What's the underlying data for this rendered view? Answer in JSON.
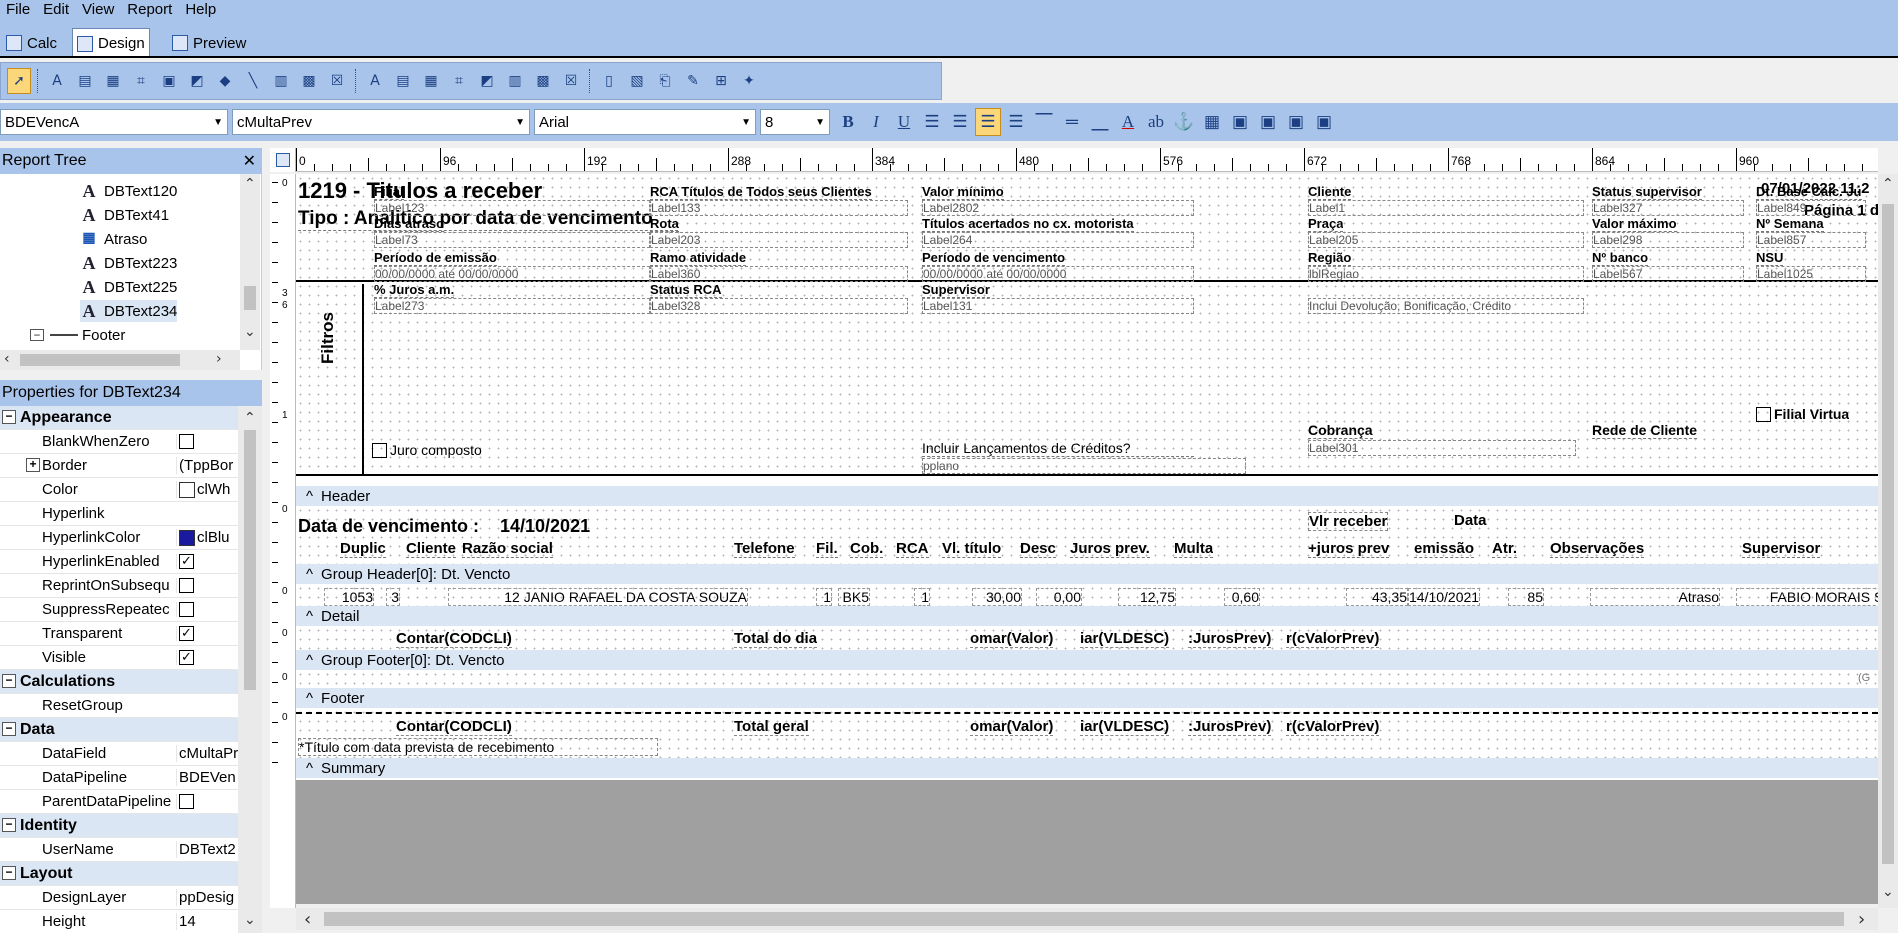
{
  "menu": [
    "File",
    "Edit",
    "View",
    "Report",
    "Help"
  ],
  "view_tabs": [
    "Calc",
    "Design",
    "Preview"
  ],
  "toolbar2": {
    "pipeline": "BDEVencA",
    "field": "cMultaPrev",
    "font": "Arial",
    "size": "8"
  },
  "tree": {
    "title": "Report Tree",
    "items": [
      "DBText120",
      "DBText41",
      "Atraso",
      "DBText223",
      "DBText225",
      "DBText234",
      "Footer"
    ]
  },
  "props": {
    "title": "Properties for DBText234",
    "rows": [
      {
        "cat": true,
        "name": "Appearance"
      },
      {
        "name": "BlankWhenZero",
        "check": ""
      },
      {
        "name": "Border",
        "value": "(TppBor",
        "expand": "+"
      },
      {
        "name": "Color",
        "value": "clWh",
        "swatch": "#ffffff"
      },
      {
        "name": "Hyperlink",
        "value": ""
      },
      {
        "name": "HyperlinkColor",
        "value": "clBlu",
        "swatch": "#1a1a9e"
      },
      {
        "name": "HyperlinkEnabled",
        "check": "✓"
      },
      {
        "name": "ReprintOnSubsequ",
        "check": ""
      },
      {
        "name": "SuppressRepeatec",
        "check": ""
      },
      {
        "name": "Transparent",
        "check": "✓"
      },
      {
        "name": "Visible",
        "check": "✓"
      },
      {
        "cat": true,
        "name": "Calculations"
      },
      {
        "name": "ResetGroup",
        "value": ""
      },
      {
        "cat": true,
        "name": "Data"
      },
      {
        "name": "DataField",
        "value": "cMultaPr"
      },
      {
        "name": "DataPipeline",
        "value": "BDEVen"
      },
      {
        "name": "ParentDataPipeline",
        "check": ""
      },
      {
        "cat": true,
        "name": "Identity"
      },
      {
        "name": "UserName",
        "value": "DBText2"
      },
      {
        "cat": true,
        "name": "Layout"
      },
      {
        "name": "DesignLayer",
        "value": "ppDesig"
      },
      {
        "name": "Height",
        "value": "14"
      }
    ]
  },
  "ruler": [
    "0",
    "96",
    "192",
    "288",
    "384",
    "480",
    "576",
    "672",
    "768",
    "864",
    "960",
    "10"
  ],
  "vruler": [
    "0",
    "3",
    "6",
    "1",
    "0",
    "0",
    "0",
    "0",
    "0"
  ],
  "report": {
    "title": "1219 - Titulos a receber",
    "subtitle": "Tipo : Analitico por  data de vencimento",
    "date": "07/01/2022 11:2",
    "page": "Página 1 d",
    "filtros": "Filtros",
    "filters": [
      {
        "l": "Filial",
        "v": "Label123"
      },
      {
        "l": "Dias atraso",
        "v": "Label73"
      },
      {
        "l": "Período de emissão",
        "v": "00/00/0000  até  00/00/0000"
      },
      {
        "l": "% Juros a.m.",
        "v": "Label273"
      },
      {
        "l": "RCA  Títulos de Todos seus Clientes",
        "v": "Label133"
      },
      {
        "l": "Rota",
        "v": "Label203"
      },
      {
        "l": "Ramo atividade",
        "v": "Label360"
      },
      {
        "l": "Status RCA",
        "v": "Label328"
      },
      {
        "l": "Valor mínimo",
        "v": "Label2802"
      },
      {
        "l": "Títulos acertados no cx. motorista",
        "v": "Label264"
      },
      {
        "l": "Período de vencimento",
        "v": "00/00/0000  até  00/00/0000"
      },
      {
        "l": "Supervisor",
        "v": "Label131"
      },
      {
        "l": "Cliente",
        "v": "Label1"
      },
      {
        "l": "Praça",
        "v": "Label205"
      },
      {
        "l": "Região",
        "v": "lblRegiao"
      },
      {
        "l": "",
        "v": "Inclui Devolução, Bonificação, Crédito"
      },
      {
        "l": "Status supervisor",
        "v": "Label327"
      },
      {
        "l": "Valor máximo",
        "v": "Label298"
      },
      {
        "l": "Nº banco",
        "v": "Label567"
      },
      {
        "l": "Dt. Base Calc. Ju",
        "v": "Label849"
      },
      {
        "l": "Nº Semana",
        "v": "Label857"
      },
      {
        "l": "NSU",
        "v": "Label1025"
      }
    ],
    "juro": "Juro composto",
    "filial_virtual": "Filial Virtua",
    "incluir": "Incluir Lançamentos de Créditos?",
    "pplano": "pplano",
    "cobranca": "Cobrança",
    "cobranca_v": "Label301",
    "rede": "Rede de Cliente",
    "band_header": "Header",
    "group_header": "Group Header[0]: Dt. Vencto",
    "band_detail": "Detail",
    "group_footer": "Group Footer[0]: Dt. Vencto",
    "band_footer": "Footer",
    "band_summary": "Summary",
    "dv_label": "Data de vencimento :",
    "dv_value": "14/10/2021",
    "cols_top": [
      "Vlr receber",
      "Data"
    ],
    "cols": [
      "Duplic",
      "Cliente",
      "Razão social",
      "Telefone",
      "Fil.",
      "Cob.",
      "RCA",
      "Vl. título",
      "Desc",
      "Juros prev.",
      "Multa",
      "+juros prev",
      "emissão",
      "Atr.",
      "Observações",
      "Supervisor"
    ],
    "detail": [
      "1053",
      "3",
      "12 JANIO RAFAEL DA COSTA SOUZA",
      "1",
      "BK5",
      "1",
      "30,00",
      "0,00",
      "12,75",
      "0,60",
      "43,35",
      "14/10/2021",
      "85",
      "Atraso",
      "FABIO MORAIS SIL"
    ],
    "gf": [
      "Contar(CODCLI)",
      "Total do dia",
      "omar(Valor)",
      "iar(VLDESC)",
      ":JurosPrev)",
      "r(cValorPrev)"
    ],
    "ft": [
      "Contar(CODCLI)",
      "Total geral",
      "omar(Valor)",
      "iar(VLDESC)",
      ":JurosPrev)",
      "r(cValorPrev)"
    ],
    "note": "*Título com data prevista  de recebimento",
    "gf_right": "(G"
  }
}
